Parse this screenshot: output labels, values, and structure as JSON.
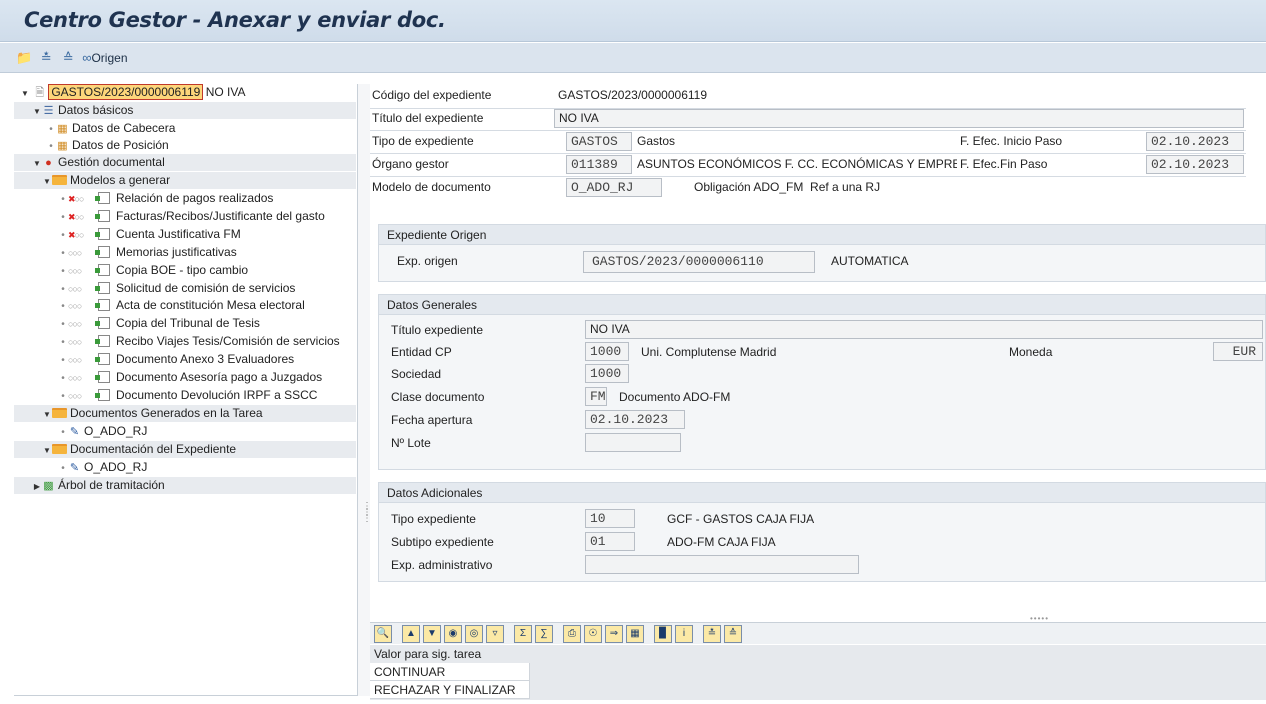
{
  "window": {
    "title": "Centro Gestor - Anexar y enviar doc."
  },
  "toolbar": {
    "origen_label": "Origen"
  },
  "tree": {
    "root_id": "GASTOS/2023/0000006119",
    "root_suffix": " NO IVA",
    "datos_basicos": "Datos básicos",
    "datos_cabecera": "Datos de Cabecera",
    "datos_posicion": "Datos de Posición",
    "gestion_documental": "Gestión documental",
    "modelos_generar": "Modelos a generar",
    "modelos": [
      "Relación de pagos realizados",
      "Facturas/Recibos/Justificante del gasto",
      "Cuenta Justificativa FM",
      "Memorias justificativas",
      "Copia BOE - tipo cambio",
      "Solicitud de comisión de servicios",
      "Acta de constitución Mesa electoral",
      "Copia del Tribunal de Tesis",
      "Recibo Viajes Tesis/Comisión de servicios",
      "Documento Anexo 3 Evaluadores",
      "Documento Asesoría pago a Juzgados",
      "Documento Devolución IRPF a SSCC"
    ],
    "docs_generados": "Documentos Generados en la Tarea",
    "doc_generado_1": "O_ADO_RJ",
    "doc_expediente": "Documentación del Expediente",
    "doc_expediente_1": "O_ADO_RJ",
    "arbol": "Árbol de tramitación"
  },
  "header": {
    "codigo_label": "Código del expediente",
    "codigo_value": "GASTOS/2023/0000006119",
    "titulo_label": "Título del expediente",
    "titulo_value": "NO IVA",
    "tipo_label": "Tipo de expediente",
    "tipo_code": "GASTOS",
    "tipo_text": "Gastos",
    "inicio_label": "F. Efec. Inicio Paso",
    "inicio_value": "02.10.2023",
    "organo_label": "Órgano gestor",
    "organo_code": "011389",
    "organo_text": "ASUNTOS ECONÓMICOS F. CC. ECONÓMICAS Y EMPRES...",
    "fin_label": "F. Efec.Fin Paso",
    "fin_value": "02.10.2023",
    "modelo_label": "Modelo de documento",
    "modelo_code": "O_ADO_RJ",
    "modelo_text": "Obligación ADO_FM  Ref a una RJ"
  },
  "expediente_origen": {
    "title": "Expediente Origen",
    "label": "Exp. origen",
    "value": "GASTOS/2023/0000006110",
    "text": "AUTOMATICA"
  },
  "datos_generales": {
    "title": "Datos Generales",
    "titulo_label": "Título expediente",
    "titulo_value": "NO IVA",
    "entidad_label": "Entidad CP",
    "entidad_code": "1000",
    "entidad_text": "Uni. Complutense Madrid",
    "moneda_label": "Moneda",
    "moneda_value": "EUR",
    "sociedad_label": "Sociedad",
    "sociedad_value": "1000",
    "clase_label": "Clase documento",
    "clase_code": "FM",
    "clase_text": "Documento ADO-FM",
    "fecha_label": "Fecha apertura",
    "fecha_value": "02.10.2023",
    "lote_label": "Nº Lote",
    "lote_value": ""
  },
  "datos_adicionales": {
    "title": "Datos Adicionales",
    "tipo_label": "Tipo expediente",
    "tipo_code": "10",
    "tipo_text": "GCF - GASTOS CAJA FIJA",
    "subtipo_label": "Subtipo expediente",
    "subtipo_code": "01",
    "subtipo_text": "ADO-FM CAJA FIJA",
    "admin_label": "Exp. administrativo",
    "admin_value": ""
  },
  "next_task": {
    "header": "Valor para sig. tarea",
    "options": [
      "CONTINUAR TRAMITACIÓN",
      "RECHAZAR Y FINALIZAR"
    ]
  }
}
